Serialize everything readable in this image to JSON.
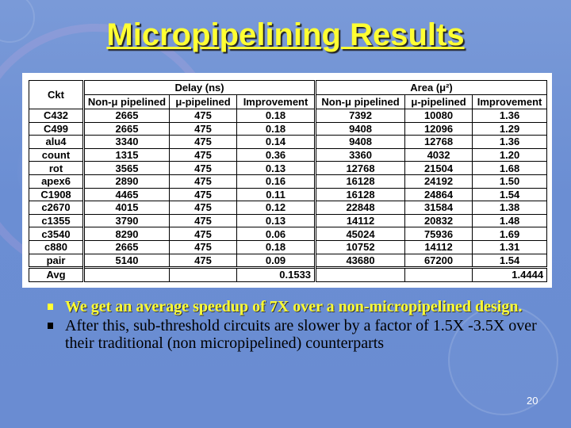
{
  "slide": {
    "title": "Micropipelining Results",
    "page_number": "20",
    "colors": {
      "title": "#ffff33",
      "background": "#6b8ed3",
      "highlight_bullet": "#ffff33"
    }
  },
  "table": {
    "ckt_header": "Ckt",
    "group_headers": [
      "Delay (ns)",
      "Area (μ²)"
    ],
    "sub_headers": [
      "Non-μ pipelined",
      "μ-pipelined",
      "Improvement",
      "Non-μ pipelined",
      "μ-pipelined",
      "Improvement"
    ],
    "rows": [
      [
        "C432",
        "2665",
        "475",
        "0.18",
        "7392",
        "10080",
        "1.36"
      ],
      [
        "C499",
        "2665",
        "475",
        "0.18",
        "9408",
        "12096",
        "1.29"
      ],
      [
        "alu4",
        "3340",
        "475",
        "0.14",
        "9408",
        "12768",
        "1.36"
      ],
      [
        "count",
        "1315",
        "475",
        "0.36",
        "3360",
        "4032",
        "1.20"
      ],
      [
        "rot",
        "3565",
        "475",
        "0.13",
        "12768",
        "21504",
        "1.68"
      ],
      [
        "apex6",
        "2890",
        "475",
        "0.16",
        "16128",
        "24192",
        "1.50"
      ],
      [
        "C1908",
        "4465",
        "475",
        "0.11",
        "16128",
        "24864",
        "1.54"
      ],
      [
        "c2670",
        "4015",
        "475",
        "0.12",
        "22848",
        "31584",
        "1.38"
      ],
      [
        "c1355",
        "3790",
        "475",
        "0.13",
        "14112",
        "20832",
        "1.48"
      ],
      [
        "c3540",
        "8290",
        "475",
        "0.06",
        "45024",
        "75936",
        "1.69"
      ],
      [
        "c880",
        "2665",
        "475",
        "0.18",
        "10752",
        "14112",
        "1.31"
      ],
      [
        "pair",
        "5140",
        "475",
        "0.09",
        "43680",
        "67200",
        "1.54"
      ]
    ],
    "avg_row": [
      "Avg",
      "",
      "",
      "0.1533",
      "",
      "",
      "1.4444"
    ]
  },
  "bullets": [
    {
      "text": "We get an average speedup of 7X over a non-micropipelined design.",
      "highlight": true
    },
    {
      "text": "After this, sub-threshold circuits are slower by a factor of 1.5X -3.5X over their traditional (non micropipelined) counterparts",
      "highlight": false
    }
  ]
}
